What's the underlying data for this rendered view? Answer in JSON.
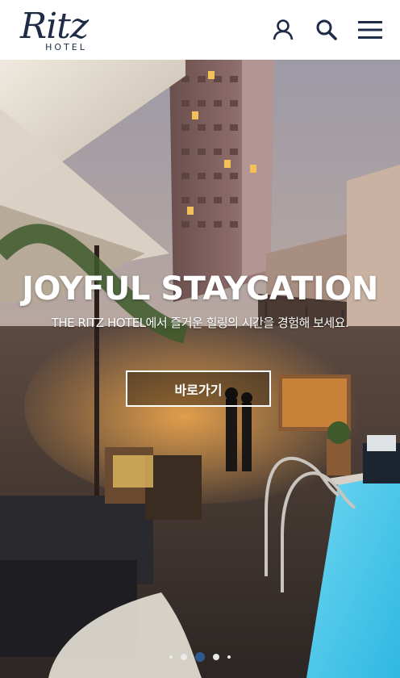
{
  "header": {
    "logo_script": "Ritz",
    "logo_sub": "HOTEL",
    "account_icon": "person-icon",
    "search_icon": "search-icon",
    "menu_icon": "hamburger-menu-icon"
  },
  "hero": {
    "title": "JOYFUL STAYCATION",
    "subtitle": "THE RITZ HOTEL에서 즐거운 힐링의 시간을 경험해 보세요.",
    "cta_label": "바로가기"
  },
  "carousel": {
    "slide_count": 5,
    "active_index": 2
  },
  "colors": {
    "brand_navy": "#1e2c47",
    "active_dot": "#2d5b8f",
    "inactive_dot": "#e9e9e9"
  }
}
